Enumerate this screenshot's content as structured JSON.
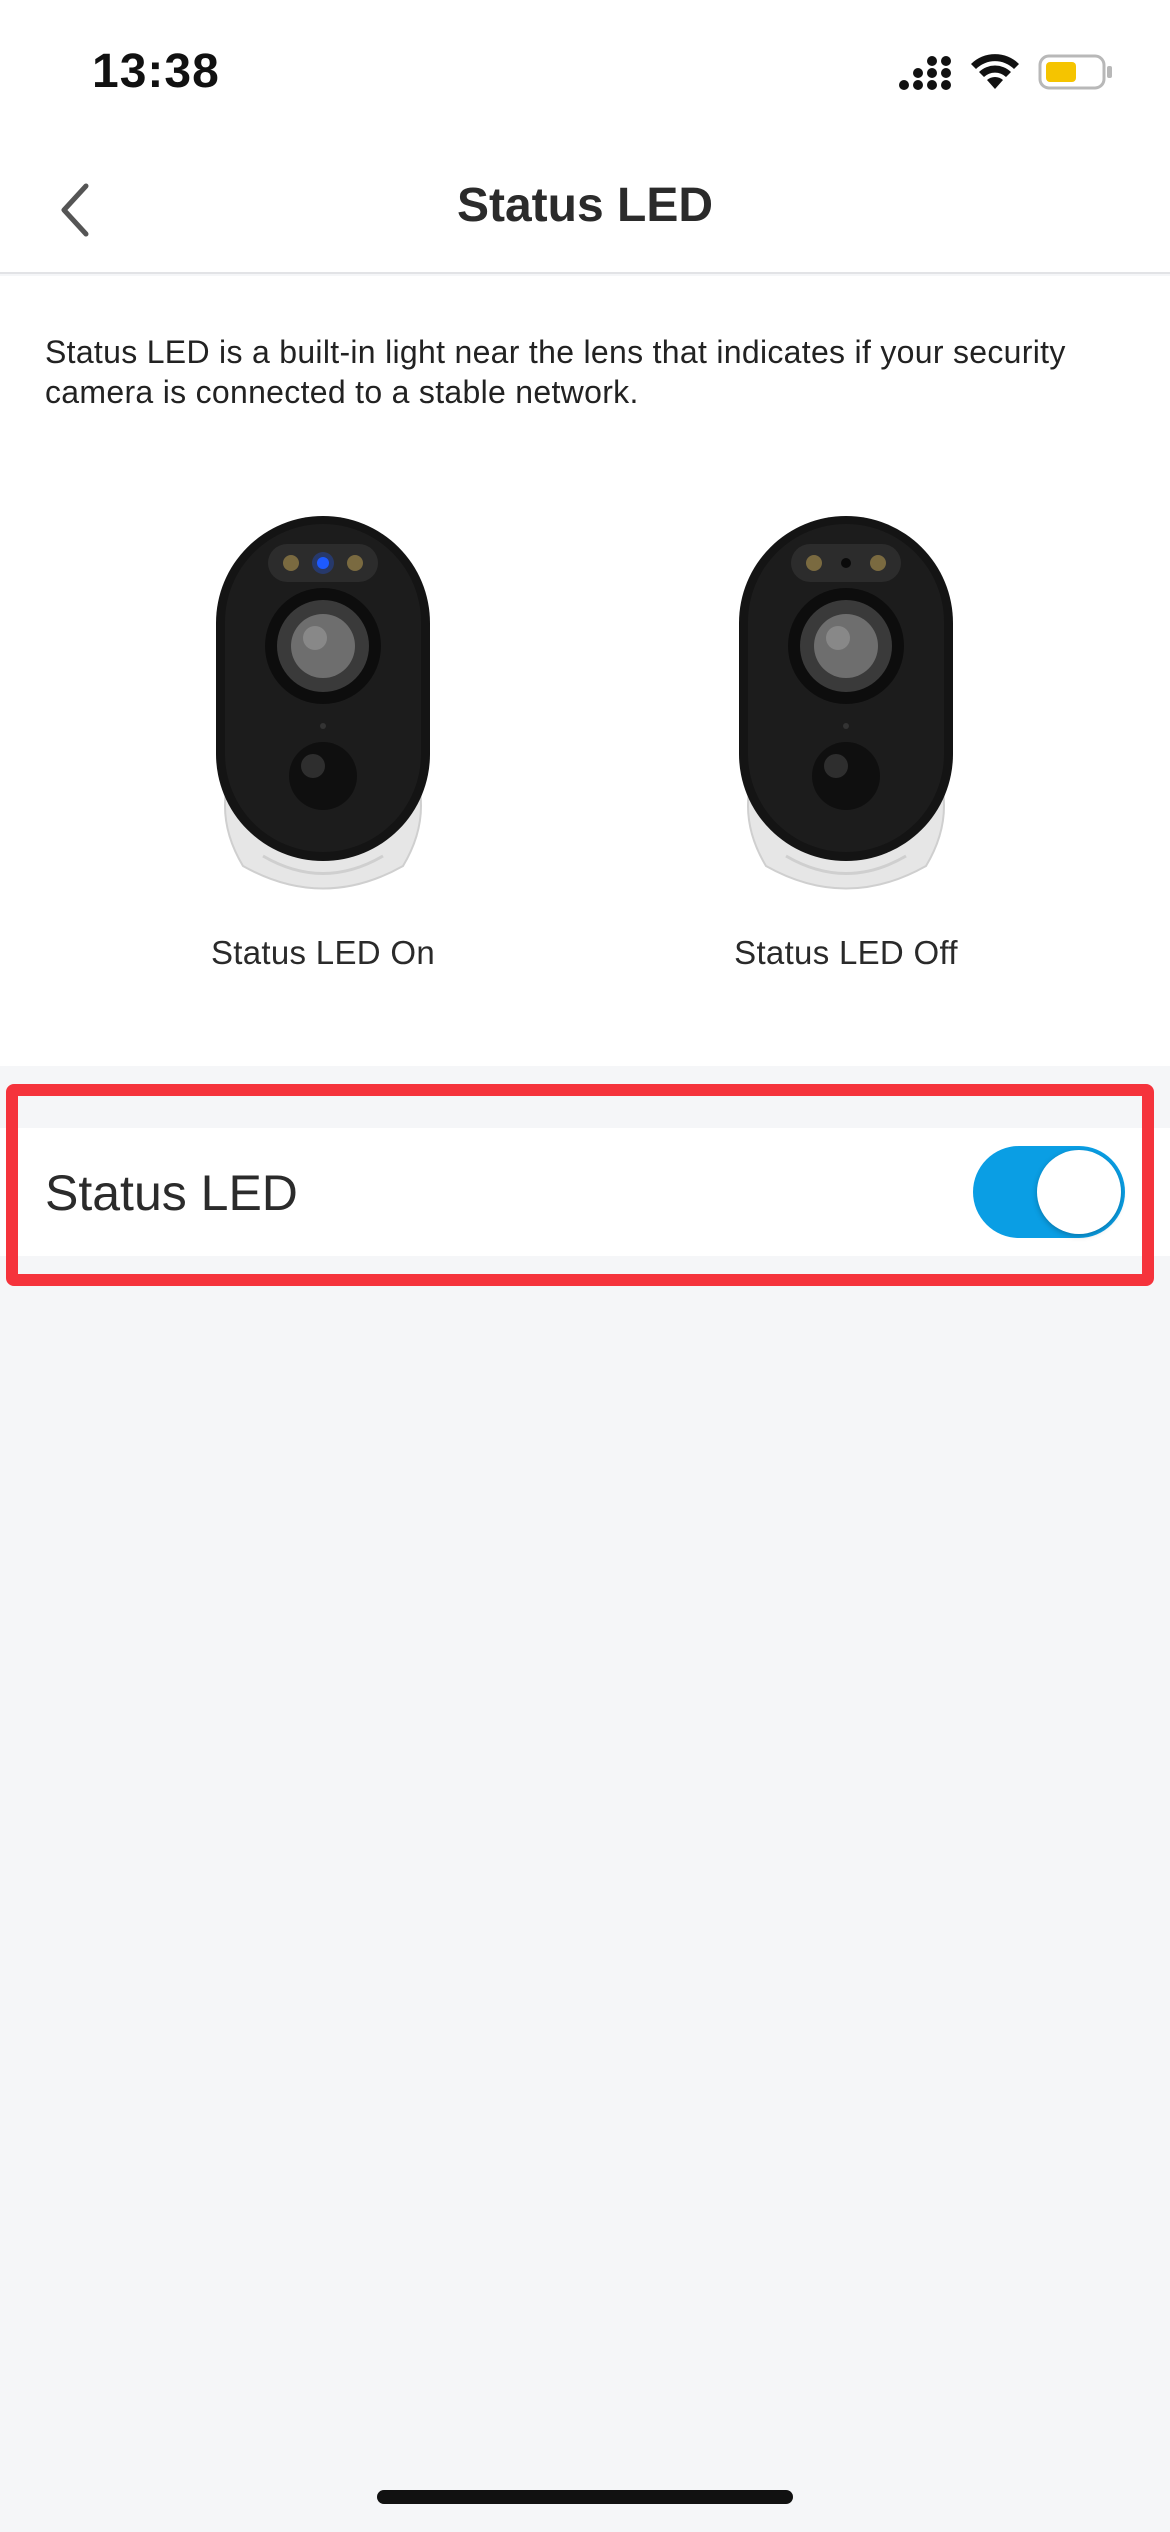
{
  "status_bar": {
    "time": "13:38",
    "icons": [
      "cellular-signal-icon",
      "wifi-icon",
      "battery-icon"
    ],
    "battery_color": "#f5c400"
  },
  "nav": {
    "back_icon": "chevron-left-icon",
    "title": "Status LED"
  },
  "content": {
    "description": "Status LED is a built-in light near the lens that indicates if your security camera is connected to a stable network.",
    "cameras": [
      {
        "caption": "Status LED On",
        "led": "on",
        "led_color": "#1e5bff"
      },
      {
        "caption": "Status LED Off",
        "led": "off"
      }
    ]
  },
  "setting": {
    "label": "Status LED",
    "enabled": true,
    "toggle_color": "#0a9ee4"
  },
  "highlight_color": "#f5333c"
}
